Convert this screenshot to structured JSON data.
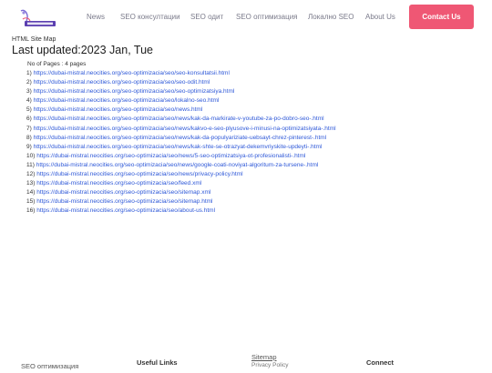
{
  "header": {
    "nav": [
      "News",
      "SEO консултации",
      "SEO одит",
      "SEO оптимизация",
      "Локално SEO",
      "About Us"
    ],
    "contact_label": "Contact Us"
  },
  "breadcrumb": "HTML Site Map",
  "last_updated": "Last updated:2023 Jan, Tue",
  "pages_count": "No of Pages : 4 pages",
  "links": [
    "https://dubai-mistral.neocities.org/seo-optimizacia/seo/seo-konsultatsii.html",
    "https://dubai-mistral.neocities.org/seo-optimizacia/seo/seo-odit.html",
    "https://dubai-mistral.neocities.org/seo-optimizacia/seo/seo-optimizatsiya.html",
    "https://dubai-mistral.neocities.org/seo-optimizacia/seo/lokalno-seo.html",
    "https://dubai-mistral.neocities.org/seo-optimizacia/seo/news.html",
    "https://dubai-mistral.neocities.org/seo-optimizacia/seo/news/kak-da-markirate-v-youtube-za-po-dobro-seo-.html",
    "https://dubai-mistral.neocities.org/seo-optimizacia/seo/news/kakvo-e-seo-plyusove-i-minusi-na-optimizatsiyata-.html",
    "https://dubai-mistral.neocities.org/seo-optimizacia/seo/news/kak-da-populyariziate-uebsayt-chrez-pinterest-.html",
    "https://dubai-mistral.neocities.org/seo-optimizacia/seo/news/kak-shte-se-otrazyat-dekemvriyskite-updeyti-.html",
    "https://dubai-mistral.neocities.org/seo-optimizacia/seo/news/5-seo-optimizatsiya-ot-profesionalisti-.html",
    "https://dubai-mistral.neocities.org/seo-optimizacia/seo/news/google-coati-noviyat-algoritum-za-tursene-.html",
    "https://dubai-mistral.neocities.org/seo-optimizacia/seo/news/privacy-policy.html",
    "https://dubai-mistral.neocities.org/seo-optimizacia/seo/feed.xml",
    "https://dubai-mistral.neocities.org/seo-optimizacia/seo/sitemap.xml",
    "https://dubai-mistral.neocities.org/seo-optimizacia/seo/sitemap.html",
    "https://dubai-mistral.neocities.org/seo-optimizacia/seo/about-us.html"
  ],
  "footer": {
    "col1": "SEO оптимизация",
    "col2": "Useful Links",
    "col3": "Sitemap",
    "col3_sub": "Privacy Policy",
    "col4": "Connect"
  },
  "colors": {
    "accent": "#ef5774",
    "link": "#2e58d8",
    "nav_text": "#7a7a8a"
  }
}
